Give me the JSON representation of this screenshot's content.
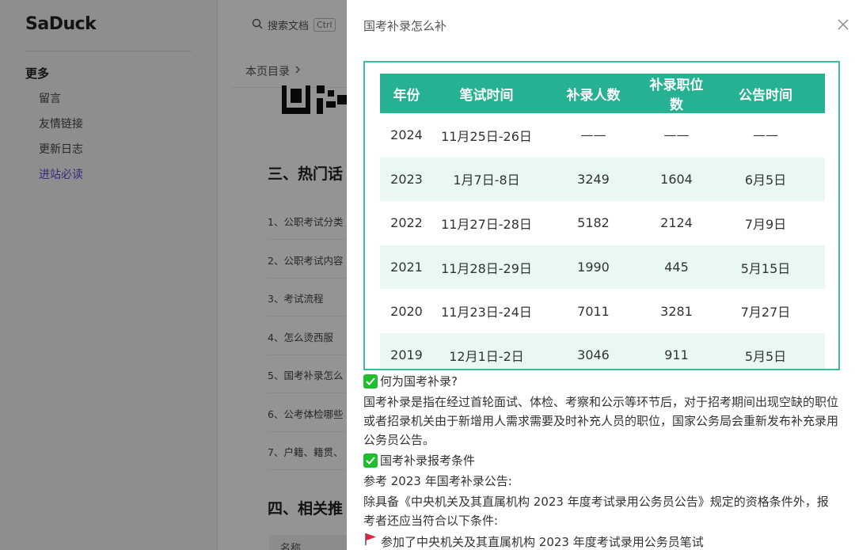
{
  "background": {
    "logo": "SaDuck",
    "nav": {
      "group_title": "更多",
      "items": [
        "留言",
        "友情链接",
        "更新日志",
        "进站必读"
      ]
    },
    "search": {
      "placeholder": "搜索文档",
      "shortcut": "Ctrl"
    },
    "toc_label": "本页目录",
    "heading_3": "三、热门话",
    "list": [
      "1、公职考试分类",
      "2、公职考试内容",
      "3、考试流程",
      "4、怎么烫西服",
      "5、国考补录怎么",
      "6、公考体检哪些",
      "7、户籍、籍贯、"
    ],
    "heading_4": "四、相关推",
    "table_head": "名称"
  },
  "modal": {
    "title": "国考补录怎么补",
    "table": {
      "headers": [
        "年份",
        "笔试时间",
        "补录人数",
        "补录职位数",
        "公告时间"
      ],
      "rows": [
        [
          "2024",
          "11月25日-26日",
          "——",
          "——",
          "——"
        ],
        [
          "2023",
          "1月7日-8日",
          "3249",
          "1604",
          "6月5日"
        ],
        [
          "2022",
          "11月27日-28日",
          "5182",
          "2124",
          "7月9日"
        ],
        [
          "2021",
          "11月28日-29日",
          "1990",
          "445",
          "5月15日"
        ],
        [
          "2020",
          "11月23日-24日",
          "7011",
          "3281",
          "7月27日"
        ],
        [
          "2019",
          "12月1日-2日",
          "3046",
          "911",
          "5月5日"
        ]
      ]
    },
    "q1": "何为国考补录?",
    "p1": "国考补录是指在经过首轮面试、体检、考察和公示等环节后，对于招考期间出现空缺的职位或者招录机关由于新增用人需求需要及时补充人员的职位，国家公务局会重新发布补充录用公务员公告。",
    "q2": "国考补录报考条件",
    "p2": "参考 2023 年国考补录公告:",
    "p3": "除具备《中央机关及其直属机构 2023 年度考试录用公务员公告》规定的资格条件外，报考者还应当符合以下条件:",
    "p4": "参加了中央机关及其直属机构 2023 年度考试录用公务员笔试"
  }
}
